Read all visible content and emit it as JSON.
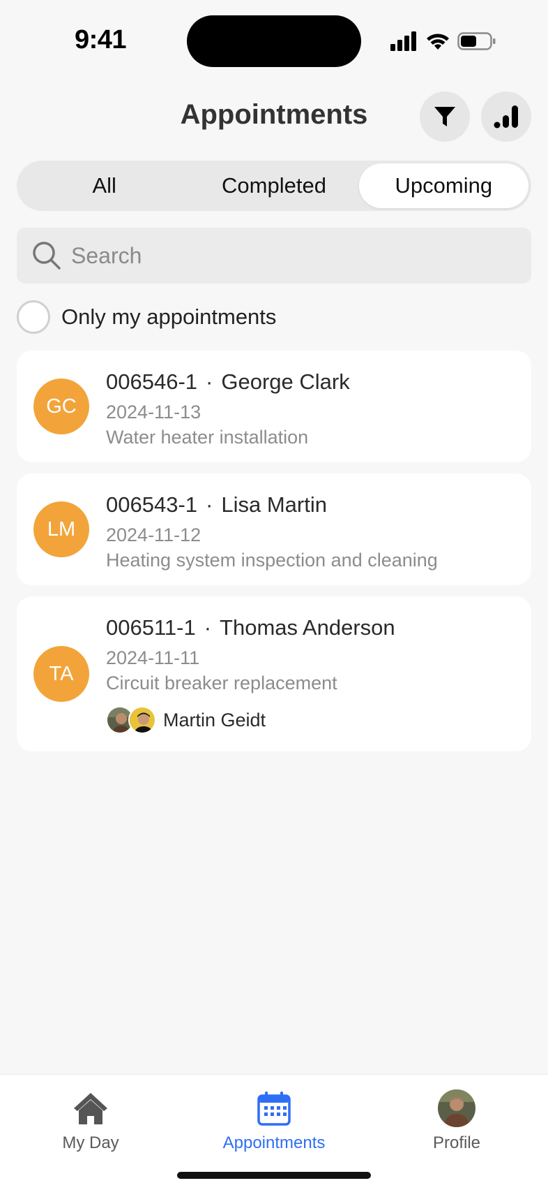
{
  "status_bar": {
    "time": "9:41"
  },
  "header": {
    "title": "Appointments",
    "filter_icon": "filter-funnel-icon",
    "sort_icon": "bar-chart-icon"
  },
  "tabs": [
    {
      "label": "All",
      "active": false
    },
    {
      "label": "Completed",
      "active": false
    },
    {
      "label": "Upcoming",
      "active": true
    }
  ],
  "search": {
    "placeholder": "Search",
    "value": ""
  },
  "filter_toggle": {
    "label": "Only my appointments",
    "checked": false
  },
  "appointments": [
    {
      "initials": "GC",
      "number": "006546-1",
      "separator": "·",
      "customer": "George Clark",
      "date": "2024-11-13",
      "description": "Water heater installation"
    },
    {
      "initials": "LM",
      "number": "006543-1",
      "separator": "·",
      "customer": "Lisa Martin",
      "date": "2024-11-12",
      "description": "Heating system inspection and cleaning"
    },
    {
      "initials": "TA",
      "number": "006511-1",
      "separator": "·",
      "customer": "Thomas Anderson",
      "date": "2024-11-11",
      "description": "Circuit breaker replacement",
      "assignee": "Martin Geidt"
    }
  ],
  "bottom_nav": [
    {
      "label": "My Day",
      "icon": "home-icon",
      "active": false
    },
    {
      "label": "Appointments",
      "icon": "calendar-icon",
      "active": true
    },
    {
      "label": "Profile",
      "icon": "profile-avatar",
      "active": false
    }
  ],
  "colors": {
    "accent": "#2f6ef6",
    "avatar_orange": "#f2a43a",
    "background": "#f7f7f7"
  }
}
